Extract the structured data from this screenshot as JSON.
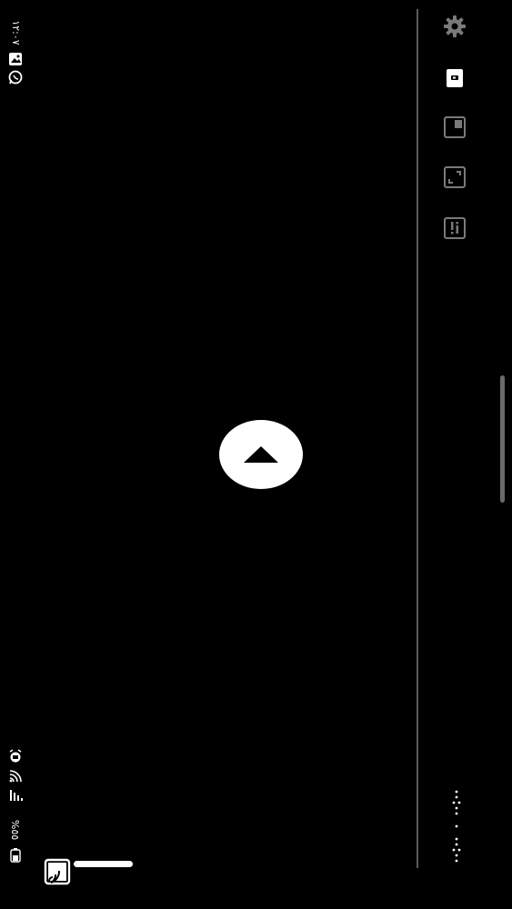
{
  "status_bar": {
    "time": "١٢:٠٧",
    "battery_text": "%٥٥",
    "icons": [
      "gallery-icon",
      "whatsapp-icon",
      "alarm-icon",
      "wifi-icon",
      "signal-icon",
      "battery-icon"
    ]
  },
  "side_toolbar": {
    "items": [
      "settings-icon",
      "screen-mode-icon",
      "bookmark-icon",
      "expand-icon",
      "info-icon"
    ],
    "accent": "#7a7a7a"
  },
  "main": {
    "up_button_icon": "up-arrow-icon"
  },
  "nav": {
    "cast_icon": "cast-icon"
  }
}
